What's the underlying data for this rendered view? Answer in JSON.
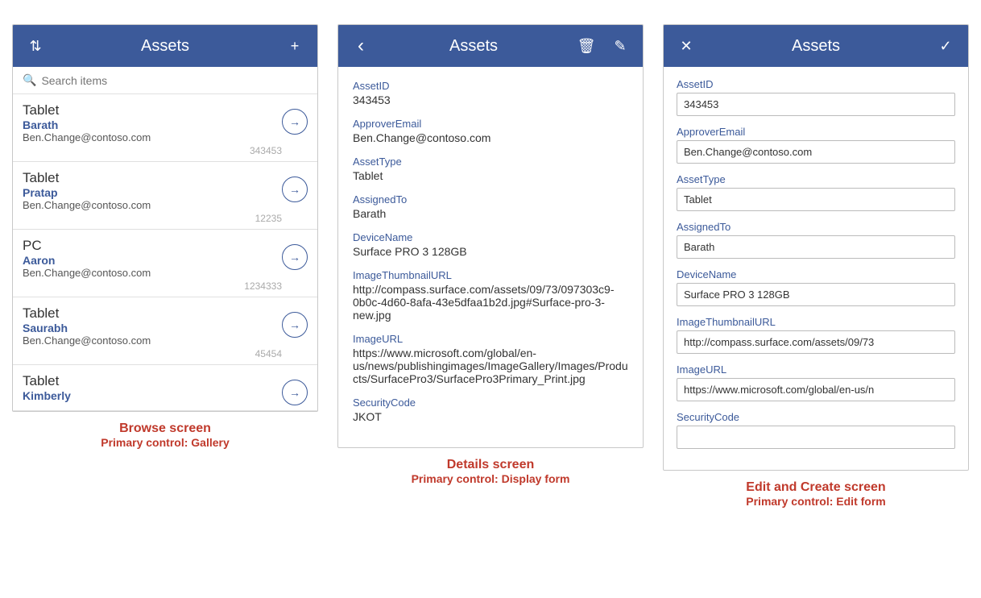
{
  "browse": {
    "header": {
      "title": "Assets",
      "sort_icon": "⇅",
      "add_icon": "+"
    },
    "search_placeholder": "Search items",
    "items": [
      {
        "title": "Tablet",
        "subtitle": "Barath",
        "email": "Ben.Change@contoso.com",
        "id": "343453"
      },
      {
        "title": "Tablet",
        "subtitle": "Pratap",
        "email": "Ben.Change@contoso.com",
        "id": "12235"
      },
      {
        "title": "PC",
        "subtitle": "Aaron",
        "email": "Ben.Change@contoso.com",
        "id": "1234333"
      },
      {
        "title": "Tablet",
        "subtitle": "Saurabh",
        "email": "Ben.Change@contoso.com",
        "id": "45454"
      },
      {
        "title": "Tablet",
        "subtitle": "Kimberly",
        "email": "",
        "id": ""
      }
    ],
    "label_main": "Browse screen",
    "label_sub": "Primary control: Gallery"
  },
  "details": {
    "header": {
      "title": "Assets",
      "back_icon": "‹",
      "delete_icon": "🗑",
      "edit_icon": "✎"
    },
    "fields": [
      {
        "label": "AssetID",
        "value": "343453"
      },
      {
        "label": "ApproverEmail",
        "value": "Ben.Change@contoso.com"
      },
      {
        "label": "AssetType",
        "value": "Tablet"
      },
      {
        "label": "AssignedTo",
        "value": "Barath"
      },
      {
        "label": "DeviceName",
        "value": "Surface PRO 3 128GB"
      },
      {
        "label": "ImageThumbnailURL",
        "value": "http://compass.surface.com/assets/09/73/097303c9-0b0c-4d60-8afa-43e5dfaa1b2d.jpg#Surface-pro-3-new.jpg"
      },
      {
        "label": "ImageURL",
        "value": "https://www.microsoft.com/global/en-us/news/publishingimages/ImageGallery/Images/Products/SurfacePro3/SurfacePro3Primary_Print.jpg"
      },
      {
        "label": "SecurityCode",
        "value": "JKOT"
      }
    ],
    "label_main": "Details screen",
    "label_sub": "Primary control: Display form"
  },
  "edit": {
    "header": {
      "title": "Assets",
      "close_icon": "✕",
      "check_icon": "✓"
    },
    "fields": [
      {
        "label": "AssetID",
        "value": "343453"
      },
      {
        "label": "ApproverEmail",
        "value": "Ben.Change@contoso.com"
      },
      {
        "label": "AssetType",
        "value": "Tablet"
      },
      {
        "label": "AssignedTo",
        "value": "Barath"
      },
      {
        "label": "DeviceName",
        "value": "Surface PRO 3 128GB"
      },
      {
        "label": "ImageThumbnailURL",
        "value": "http://compass.surface.com/assets/09/73"
      },
      {
        "label": "ImageURL",
        "value": "https://www.microsoft.com/global/en-us/n"
      },
      {
        "label": "SecurityCode",
        "value": ""
      }
    ],
    "label_main": "Edit and Create screen",
    "label_sub": "Primary control: Edit form"
  }
}
